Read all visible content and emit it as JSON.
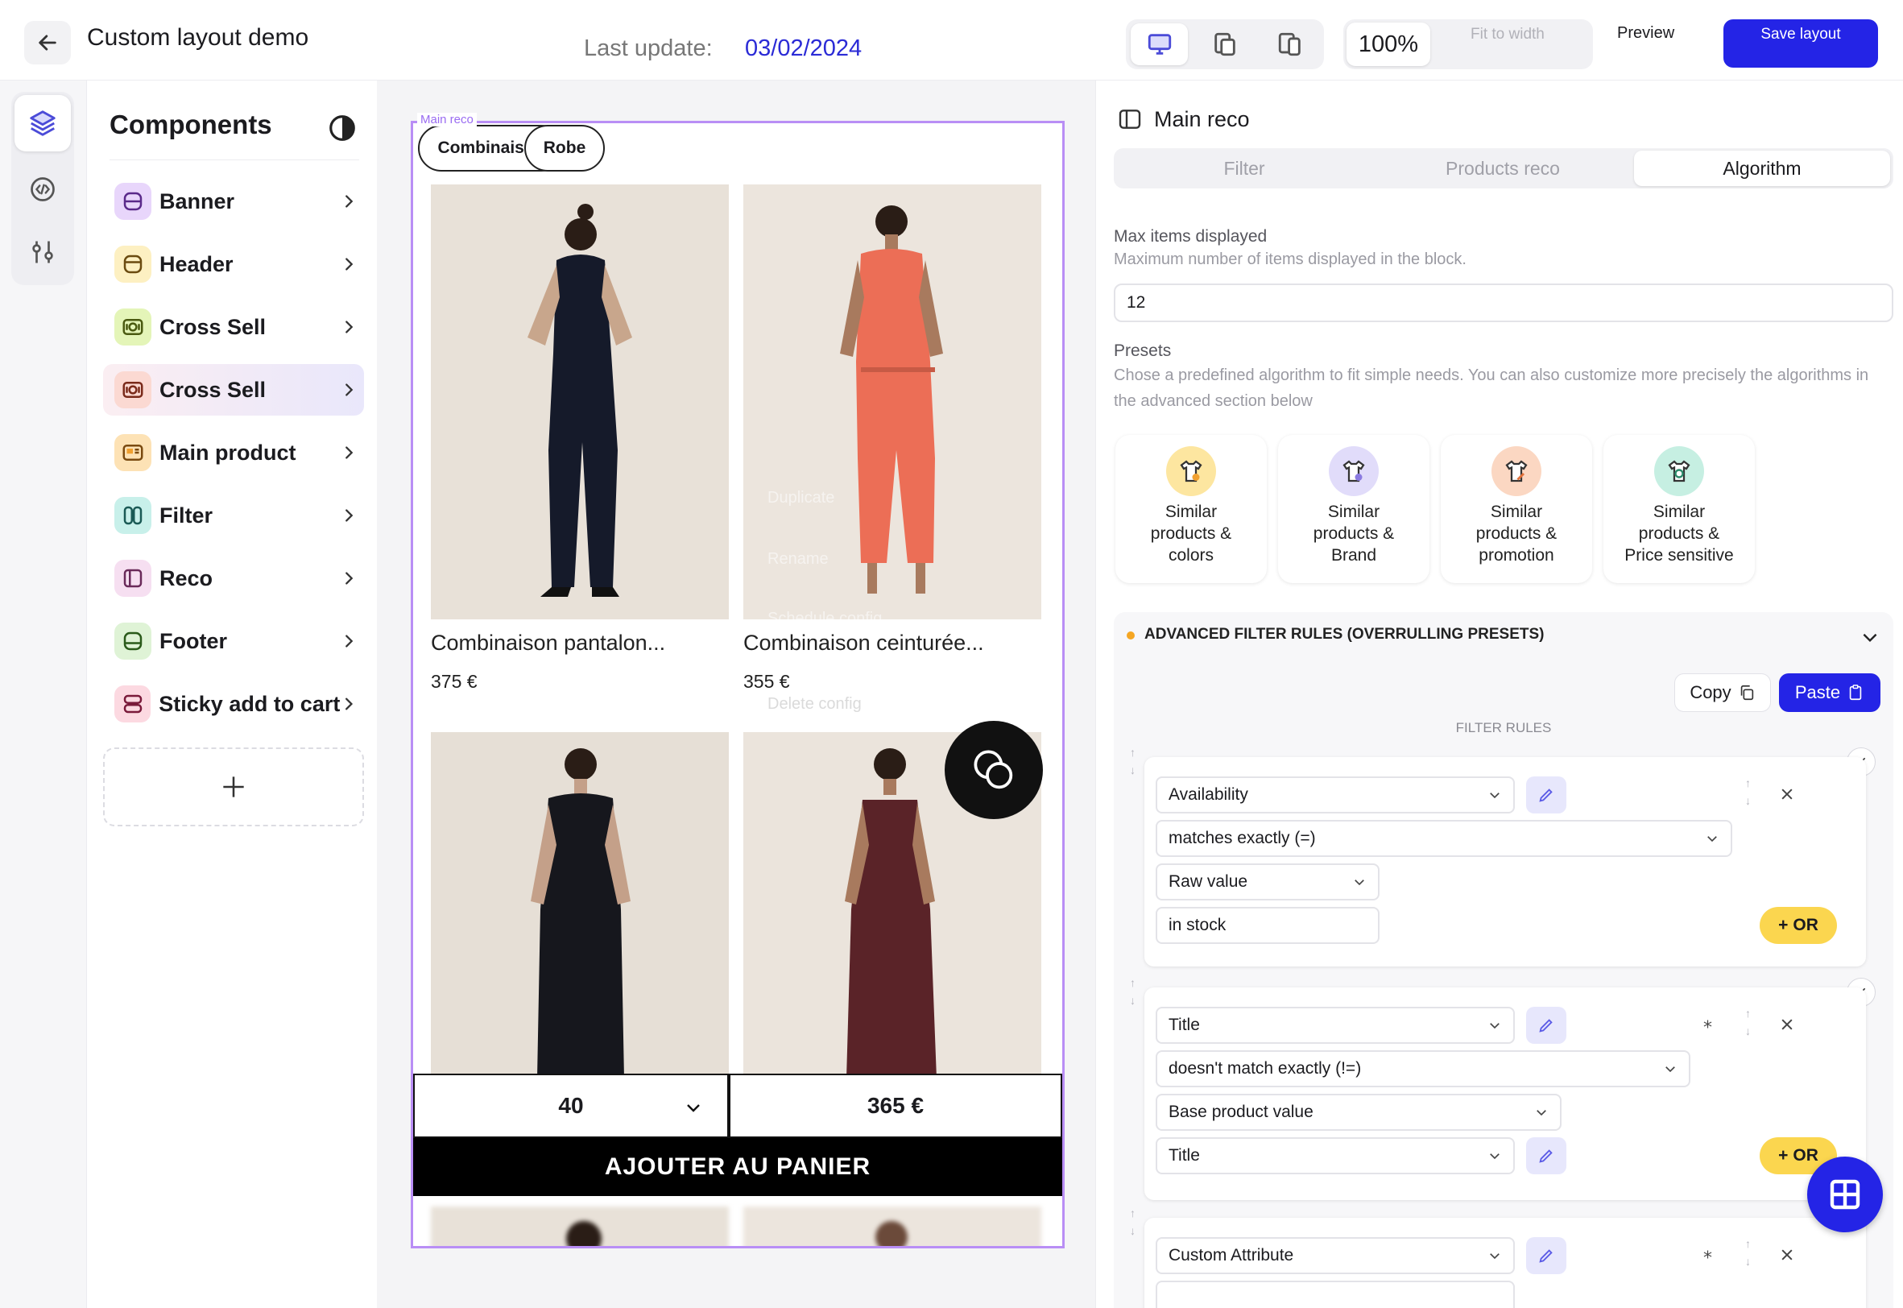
{
  "header": {
    "title": "Custom layout demo",
    "last_update_label": "Last update:",
    "last_update_date": "03/02/2024",
    "zoom": "100%",
    "fit_label": "Fit to width",
    "preview_label": "Preview",
    "save_label": "Save layout"
  },
  "components": {
    "title": "Components",
    "items": [
      {
        "label": "Banner",
        "icon": "banner-icon",
        "color": "#e8d6fb"
      },
      {
        "label": "Header",
        "icon": "header-icon",
        "color": "#fdf0c2"
      },
      {
        "label": "Cross Sell",
        "icon": "cross-sell-icon",
        "color": "#e4f5b8"
      },
      {
        "label": "Cross Sell",
        "icon": "cross-sell-icon",
        "color": "#fbd9d2"
      },
      {
        "label": "Main product",
        "icon": "main-product-icon",
        "color": "#fde2b5"
      },
      {
        "label": "Filter",
        "icon": "filter-icon",
        "color": "#c8f0ea"
      },
      {
        "label": "Reco",
        "icon": "reco-icon",
        "color": "#f6dff1"
      },
      {
        "label": "Footer",
        "icon": "footer-icon",
        "color": "#dff3d6"
      },
      {
        "label": "Sticky add to cart",
        "icon": "sticky-cart-icon",
        "color": "#fcd9e1"
      }
    ]
  },
  "canvas": {
    "frame_tag": "Main reco",
    "chips": [
      "Combinaison",
      "Robe"
    ],
    "products": [
      {
        "name": "Combinaison pantalon...",
        "price": "375 €"
      },
      {
        "name": "Combinaison ceinturée...",
        "price": "355 €"
      }
    ],
    "ghost_menu": [
      "Duplicate",
      "Rename",
      "Schedule config",
      "Delete config"
    ],
    "size_value": "40",
    "price_value": "365 €",
    "cart_label": "AJOUTER AU PANIER"
  },
  "panel": {
    "title": "Main reco",
    "tabs": [
      "Filter",
      "Products reco",
      "Algorithm"
    ],
    "max_items": {
      "label": "Max items displayed",
      "help": "Maximum number of items displayed in the block.",
      "value": "12"
    },
    "presets": {
      "label": "Presets",
      "help": "Chose a predefined algorithm to fit simple needs. You can also customize more precisely the algorithms in the advanced section below",
      "items": [
        {
          "line1": "Similar",
          "line2": "products &",
          "line3": "colors",
          "color": "#fde6a0"
        },
        {
          "line1": "Similar",
          "line2": "products &",
          "line3": "Brand",
          "color": "#e1dcfa"
        },
        {
          "line1": "Similar",
          "line2": "products &",
          "line3": "promotion",
          "color": "#fbd7c2"
        },
        {
          "line1": "Similar",
          "line2": "products &",
          "line3": "Price sensitive",
          "color": "#c6efe2"
        }
      ]
    },
    "advanced": {
      "title": "ADVANCED FILTER RULES (OVERRULLING PRESETS)",
      "copy_label": "Copy",
      "paste_label": "Paste",
      "filter_rules_label": "FILTER RULES",
      "or_label": "OR",
      "rules": [
        {
          "attribute": "Availability",
          "operator": "matches exactly (=)",
          "source": "Raw value",
          "value": "in stock"
        },
        {
          "attribute": "Title",
          "operator": "doesn't match exactly (!=)",
          "source": "Base product value",
          "value": "Title"
        },
        {
          "attribute": "Custom Attribute"
        }
      ]
    }
  }
}
